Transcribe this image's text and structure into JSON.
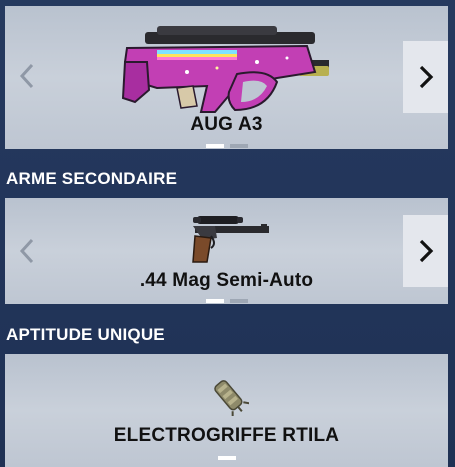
{
  "primary": {
    "name": "AUG A3",
    "pager": {
      "count": 2,
      "active_index": 0
    },
    "icons": {
      "prev": "chevron-left-icon",
      "next": "chevron-right-icon",
      "image": "aug-a3-rifle-icon"
    }
  },
  "secondary": {
    "section_title": "ARME SECONDAIRE",
    "name": ".44 Mag Semi-Auto",
    "pager": {
      "count": 2,
      "active_index": 0
    },
    "icons": {
      "prev": "chevron-left-icon",
      "next": "chevron-right-icon",
      "image": "44-mag-pistol-icon"
    }
  },
  "ability": {
    "section_title": "APTITUDE UNIQUE",
    "name": "ELECTROGRIFFE RTILA",
    "pager": {
      "count": 1,
      "active_index": 0
    },
    "icons": {
      "image": "electroclaw-gadget-icon"
    }
  },
  "colors": {
    "background": "#22355a",
    "card": "#c5ccd7",
    "arrow_button": "#e4e7ed",
    "pager_active": "#ffffff",
    "pager_inactive": "#9ea7b4",
    "weapon_skin": "#c23fb4"
  }
}
